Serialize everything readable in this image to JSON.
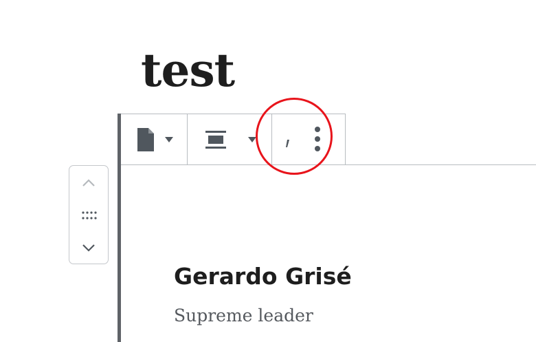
{
  "post": {
    "title": "test"
  },
  "toolbar": {
    "groups": [
      {
        "icon": "document-icon",
        "has_dropdown": true
      },
      {
        "icon": "align-wide-icon",
        "has_dropdown": true
      },
      {
        "icon": "more-options-icon",
        "has_dropdown": false
      }
    ]
  },
  "mover": {
    "up_icon": "chevron-up-icon",
    "drag_icon": "drag-handle-icon",
    "down_icon": "chevron-down-icon"
  },
  "block": {
    "name": "Gerardo Grisé",
    "role": "Supreme leader"
  },
  "colors": {
    "highlight": "#e8141b",
    "border": "#b8bcc0",
    "block_bar": "#5f6368",
    "text_dark": "#1e1e1e",
    "text_muted": "#55595e"
  }
}
